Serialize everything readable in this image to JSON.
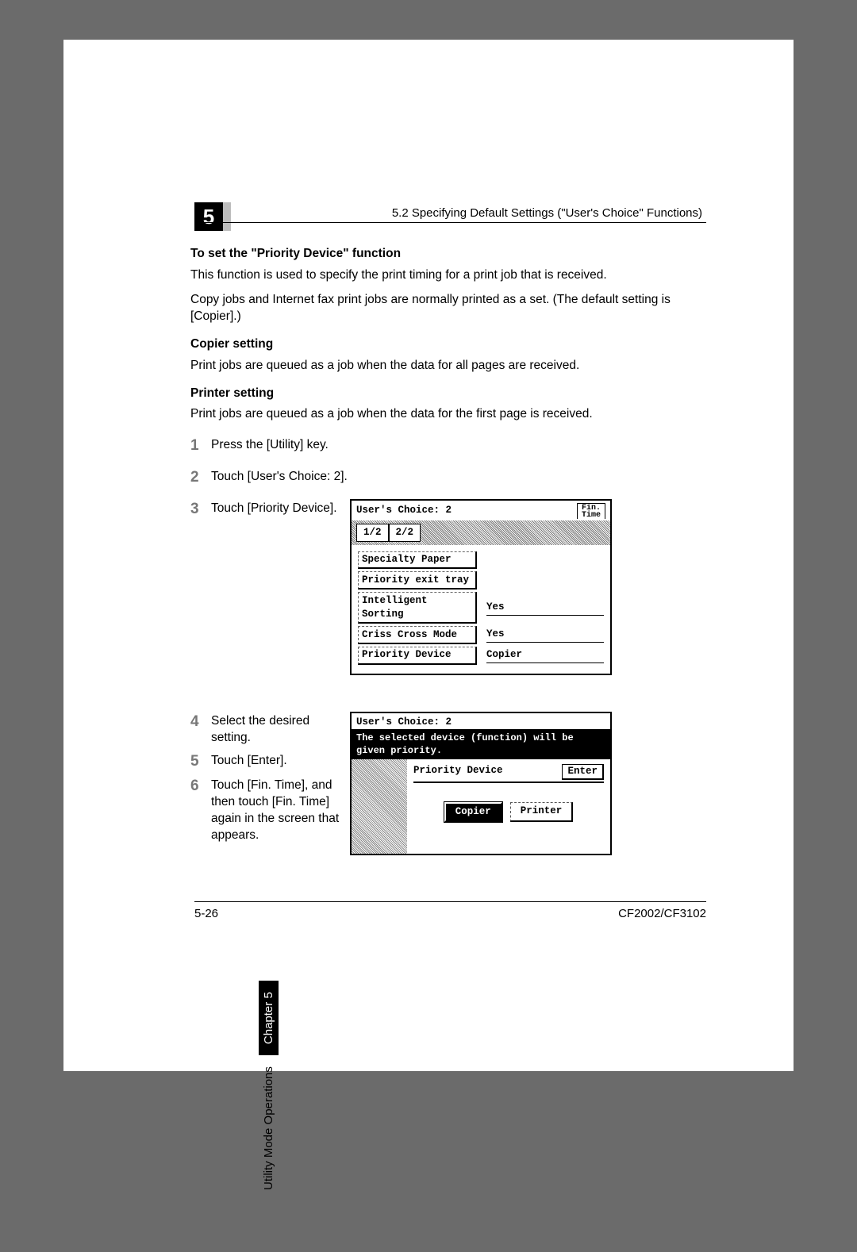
{
  "chapter_number": "5",
  "section_title": "5.2 Specifying Default Settings (\"User's Choice\" Functions)",
  "sidebar_text": "Utility Mode Operations",
  "sidebar_chapter": "Chapter 5",
  "h1": "To set the \"Priority Device\" function",
  "p1": "This function is used to specify the print timing for a print job that is received.",
  "p2": "Copy jobs and Internet fax print jobs are normally printed as a set. (The default setting is [Copier].)",
  "h2": "Copier setting",
  "p3": "Print jobs are queued as a job when the data for all pages are received.",
  "h3": "Printer setting",
  "p4": "Print jobs are queued as a job when the data for the first page is received.",
  "steps": {
    "s1": "Press the [Utility] key.",
    "s2": "Touch [User's Choice: 2].",
    "s3": "Touch [Priority Device].",
    "s4": "Select the desired setting.",
    "s5": "Touch [Enter].",
    "s6": "Touch [Fin. Time], and then touch [Fin. Time] again in the screen that appears."
  },
  "screen1": {
    "title": "User's Choice: 2",
    "fin": "Fin.\nTime",
    "tab1": "1/2",
    "tab2": "2/2",
    "items": {
      "r1": "Specialty Paper",
      "r2": "Priority exit tray",
      "r3": "Intelligent Sorting",
      "r3v": "Yes",
      "r4": "Criss Cross Mode",
      "r4v": "Yes",
      "r5": "Priority Device",
      "r5v": "Copier"
    }
  },
  "screen2": {
    "title": "User's Choice: 2",
    "msg": "The selected device (function) will be given priority.",
    "hdr": "Priority Device",
    "enter": "Enter",
    "opt1": "Copier",
    "opt2": "Printer"
  },
  "footer_left": "5-26",
  "footer_right": "CF2002/CF3102"
}
